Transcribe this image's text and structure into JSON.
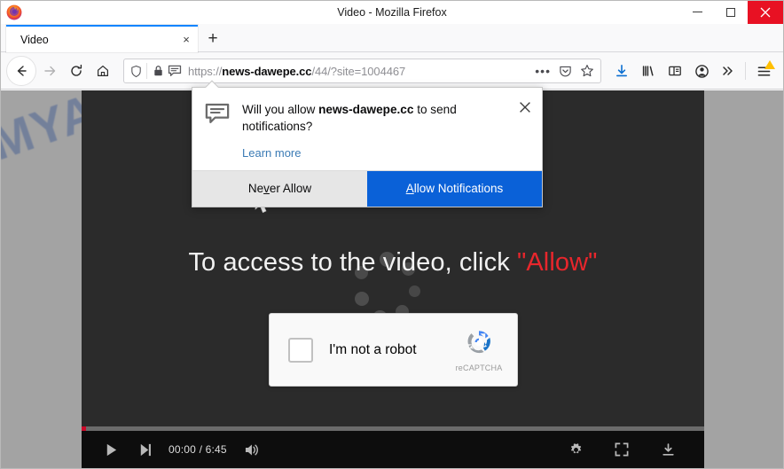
{
  "window": {
    "title": "Video - Mozilla Firefox",
    "minimize_label": "Minimize",
    "maximize_label": "Maximize",
    "close_label": "Close"
  },
  "tabs": {
    "items": [
      {
        "label": "Video",
        "close_label": "×"
      }
    ],
    "new_tab_label": "+"
  },
  "navbar": {
    "back_label": "←",
    "forward_label": "→",
    "reload_label": "↻",
    "home_label": "Home",
    "url_display_prefix": "https://",
    "url_display_host": "news-dawepe.cc",
    "url_display_path": "/44/?site=1004467 ",
    "page_actions_label": "•••",
    "icons": [
      "shield-icon",
      "lock-icon",
      "notification-permission-icon",
      "page-actions-icon",
      "pocket-icon",
      "bookmark-star-icon",
      "downloads-icon",
      "library-icon",
      "sidebar-icon",
      "account-icon",
      "overflow-icon",
      "app-menu-icon"
    ]
  },
  "notification_popup": {
    "message_prefix": "Will you allow ",
    "message_host": "news-dawepe.cc",
    "message_suffix": " to send notifications?",
    "learn_more": "Learn more",
    "close_label": "×",
    "never_allow": "Never Allow",
    "allow": "Allow Notifications",
    "allow_bg": "#0a61d8"
  },
  "page": {
    "watermark": "MYANTISPYWARE.COM",
    "watermark_color": "#2d4d8f",
    "headline_text": "To access to the video, click ",
    "headline_allow": "\"Allow\"",
    "headline_allow_color": "#e8262c",
    "background_color": "#a3a3a3",
    "video_background": "#2b2b2b"
  },
  "captcha": {
    "label": "I'm not a robot",
    "brand": "reCAPTCHA",
    "brand_color": "#9a9a9a",
    "checkbox_name": "recaptcha-checkbox"
  },
  "player": {
    "play_label": "Play",
    "next_label": "Next",
    "time_current": "00:00",
    "time_separator": " / ",
    "time_total": "6:45",
    "time_display": "00:00 / 6:45",
    "volume_label": "Volume",
    "settings_label": "Settings",
    "fullscreen_label": "Fullscreen",
    "download_label": "Download",
    "progress_color": "#cc0a2a",
    "track_color": "#6b6b6b"
  }
}
